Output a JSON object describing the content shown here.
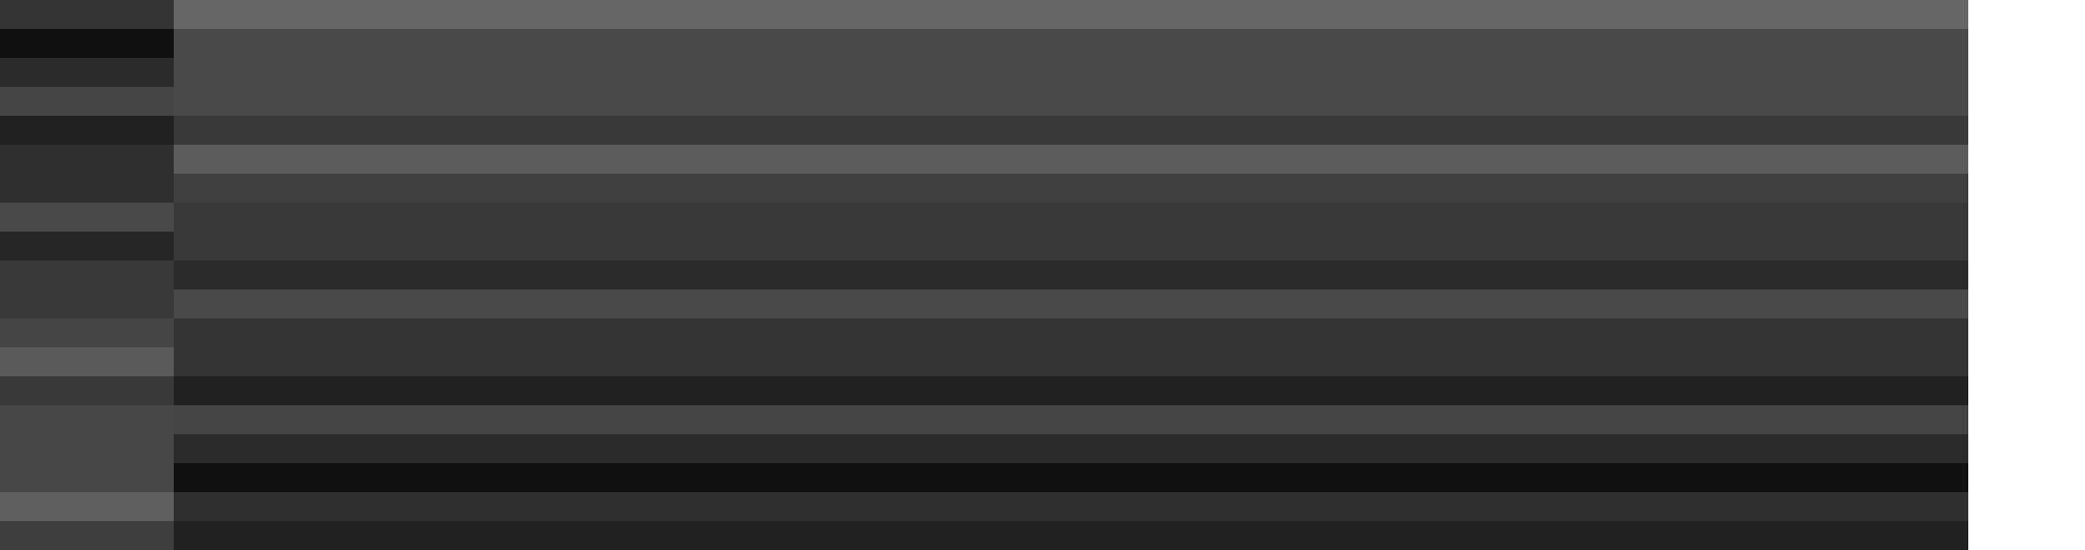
{
  "sidebar": {
    "bands": [
      {
        "color": "#333333"
      },
      {
        "color": "#111111"
      },
      {
        "color": "#2a2a2a"
      },
      {
        "color": "#444444"
      },
      {
        "color": "#222222"
      },
      {
        "color": "#303030"
      },
      {
        "color": "#4a4a4a"
      },
      {
        "color": "#252525"
      },
      {
        "color": "#3a3a3a"
      },
      {
        "color": "#444444"
      },
      {
        "color": "#5a5a5a"
      },
      {
        "color": "#393939"
      },
      {
        "color": "#474747"
      },
      {
        "color": "#606060"
      },
      {
        "color": "#3d3d3d"
      }
    ]
  },
  "main": {
    "bands": [
      {
        "color": "#666666"
      },
      {
        "color": "#4a4a4a"
      },
      {
        "color": "#3a3a3a"
      },
      {
        "color": "#5c5c5c"
      },
      {
        "color": "#404040"
      },
      {
        "color": "#393939"
      },
      {
        "color": "#2a2a2a"
      },
      {
        "color": "#4a4a4a"
      },
      {
        "color": "#333333"
      },
      {
        "color": "#222222"
      },
      {
        "color": "#444444"
      },
      {
        "color": "#2a2a2a"
      },
      {
        "color": "#111111"
      },
      {
        "color": "#303030"
      },
      {
        "color": "#222222"
      }
    ]
  }
}
